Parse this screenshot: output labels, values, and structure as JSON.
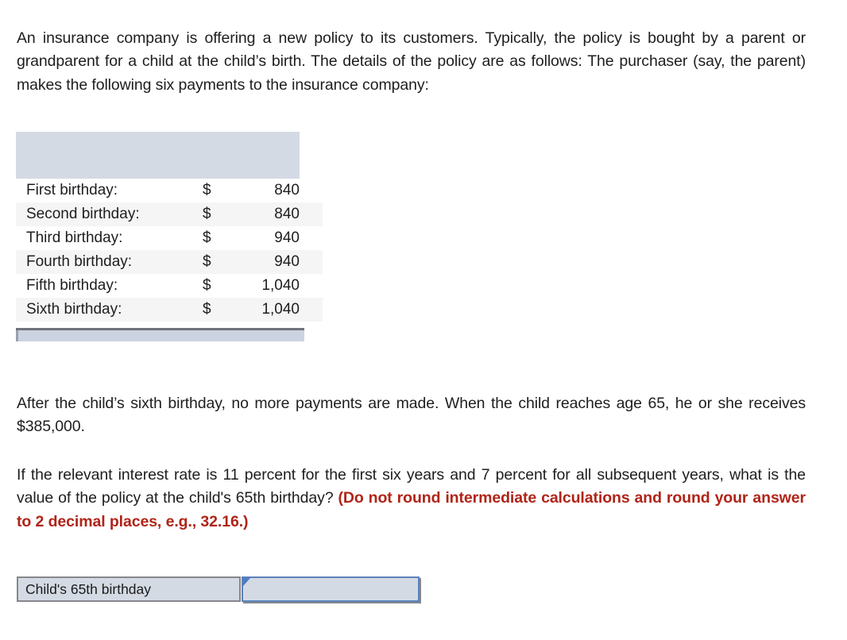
{
  "question": {
    "intro": "An insurance company is offering a new policy to its customers. Typically, the policy is bought by a parent or grandparent for a child at the child’s birth. The details of the policy are as follows: The purchaser (say, the parent) makes the following six payments to the insurance company:",
    "after_payments": "After the child’s sixth birthday, no more payments are made. When the child reaches age 65, he or she receives $385,000.",
    "rate_question": "If the relevant interest rate is 11 percent for the first six years and 7 percent for all subsequent years, what is the value of the policy at the child's 65th birthday? ",
    "rate_emphasis": "(Do not round intermediate calculations and round your answer to 2 decimal places, e.g., 32.16.)"
  },
  "payments_table": {
    "header_label": "",
    "columns": [
      "description",
      "currency_symbol",
      "amount"
    ],
    "rows": [
      {
        "label": "First birthday:",
        "symbol": "$",
        "amount": "840"
      },
      {
        "label": "Second birthday:",
        "symbol": "$",
        "amount": "840"
      },
      {
        "label": "Third birthday:",
        "symbol": "$",
        "amount": "940"
      },
      {
        "label": "Fourth birthday:",
        "symbol": "$",
        "amount": "940"
      },
      {
        "label": "Fifth birthday:",
        "symbol": "$",
        "amount": "1,040"
      },
      {
        "label": "Sixth birthday:",
        "symbol": "$",
        "amount": "1,040"
      }
    ]
  },
  "answer": {
    "label": "Child's 65th birthday",
    "value": "",
    "placeholder": ""
  },
  "colors": {
    "table_header_bg": "#d4dae4",
    "table_footer_bg": "#ccd3e0",
    "row_alt_bg": "#f5f5f5",
    "emphasis_red": "#b02418",
    "input_border_blue": "#5a82bd",
    "marker_blue": "#4a7ec2",
    "box_border_gray": "#85878c"
  }
}
